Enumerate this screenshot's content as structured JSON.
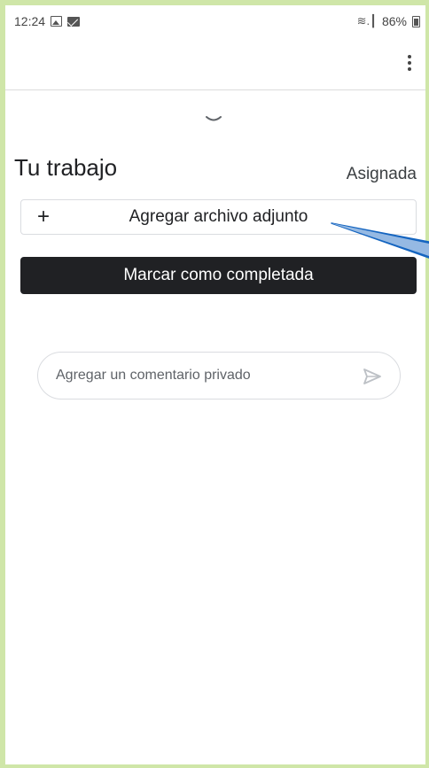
{
  "status_bar": {
    "time": "12:24",
    "signal_glyph": "≋.┃",
    "battery": "86%"
  },
  "assignment": {
    "section_title": "Tu trabajo",
    "status": "Asignada",
    "attach_label": "Agregar archivo adjunto",
    "plus_glyph": "+",
    "mark_done_label": "Marcar como completada"
  },
  "comment": {
    "placeholder": "Agregar un comentario privado"
  },
  "colors": {
    "outer_frame": "#cfe6a8",
    "primary_button": "#202124",
    "annotation_arrow": "#1565c0"
  },
  "icons": {
    "gallery": "image-icon",
    "mail": "gmail-icon",
    "wifi": "wifi-icon",
    "battery": "battery-icon",
    "menu": "more-vert-icon",
    "collapse": "chevron-down-icon",
    "add": "plus-icon",
    "send": "send-icon"
  }
}
